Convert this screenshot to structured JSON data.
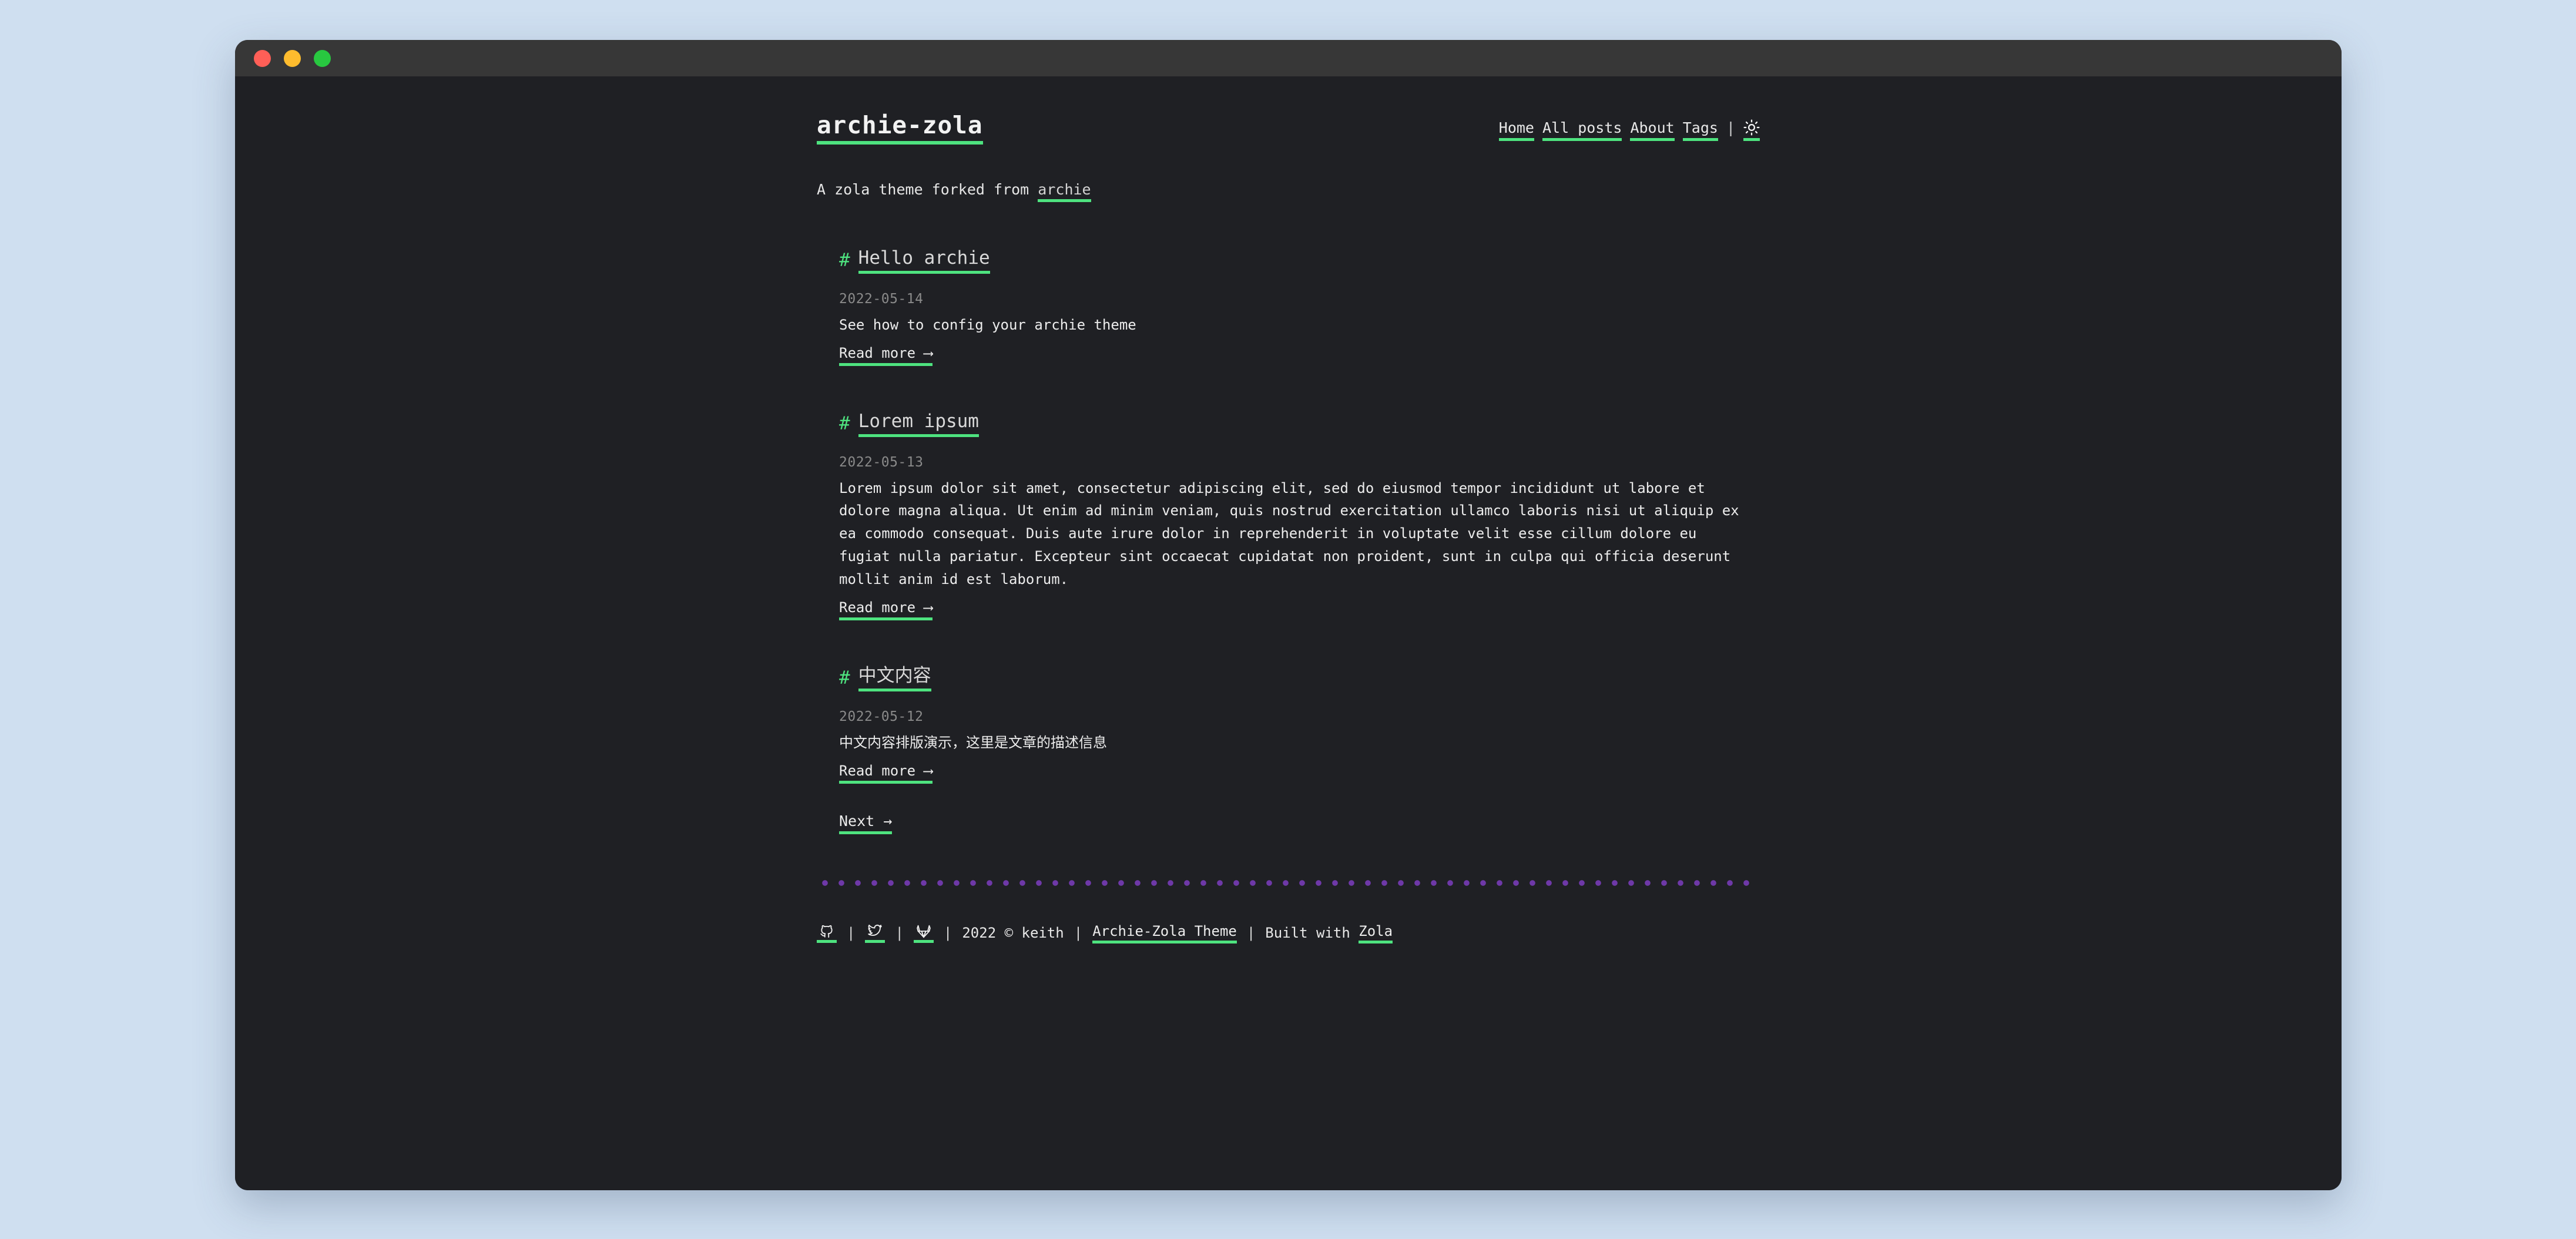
{
  "window": {
    "controls": [
      {
        "name": "close",
        "color": "#ff5f57"
      },
      {
        "name": "minimize",
        "color": "#febc2e"
      },
      {
        "name": "maximize",
        "color": "#28c840"
      }
    ]
  },
  "colors": {
    "page_background": "#cfdff0",
    "window_background": "#1f2024",
    "titlebar": "#373737",
    "accent_green": "#4ee37f",
    "divider_purple": "#6e38a8",
    "text_primary": "#ececec",
    "text_muted": "#8a8a8a"
  },
  "header": {
    "site_title": "archie-zola",
    "nav": [
      {
        "label": "Home",
        "icon": ""
      },
      {
        "label": "All posts",
        "icon": ""
      },
      {
        "label": "About",
        "icon": ""
      },
      {
        "label": "Tags",
        "icon": ""
      }
    ],
    "separator": "|",
    "theme_toggle_icon": "sun-icon"
  },
  "tagline": {
    "prefix": "A zola theme forked from ",
    "link": "archie"
  },
  "posts": [
    {
      "hash": "#",
      "title": "Hello archie",
      "date": "2022-05-14",
      "description": "See how to config your archie theme",
      "read_more": "Read more ⟶"
    },
    {
      "hash": "#",
      "title": "Lorem ipsum",
      "date": "2022-05-13",
      "description": "Lorem ipsum dolor sit amet, consectetur adipiscing elit, sed do eiusmod tempor incididunt ut labore et dolore magna aliqua. Ut enim ad minim veniam, quis nostrud exercitation ullamco laboris nisi ut aliquip ex ea commodo consequat. Duis aute irure dolor in reprehenderit in voluptate velit esse cillum dolore eu fugiat nulla pariatur. Excepteur sint occaecat cupidatat non proident, sunt in culpa qui officia deserunt mollit anim id est laborum.",
      "read_more": "Read more ⟶"
    },
    {
      "hash": "#",
      "title": "中文内容",
      "date": "2022-05-12",
      "description": "中文内容排版演示，这里是文章的描述信息",
      "read_more": "Read more ⟶"
    }
  ],
  "pagination": {
    "next_label": "Next →"
  },
  "footer": {
    "social": [
      {
        "name": "github-icon"
      },
      {
        "name": "twitter-icon"
      },
      {
        "name": "gitlab-icon"
      }
    ],
    "separator": "|",
    "copyright": "2022 © keith",
    "theme_link": "Archie-Zola Theme",
    "built_with_prefix": "Built with ",
    "built_with_link": "Zola"
  }
}
